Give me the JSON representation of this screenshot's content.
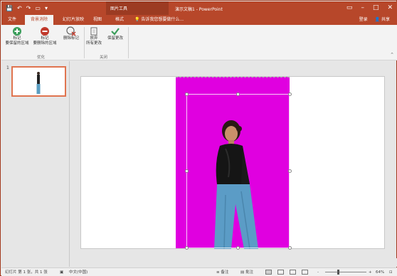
{
  "window": {
    "title": "演示文稿1 - PowerPoint",
    "context_tab_header": "图片工具"
  },
  "quick_access": {
    "save_icon": "save-icon",
    "undo_icon": "undo-icon",
    "redo_icon": "redo-icon",
    "customize_icon": "customize-icon"
  },
  "tabs": [
    {
      "label": "文件"
    },
    {
      "label": "背景消除"
    },
    {
      "label": "幻灯片放映"
    },
    {
      "label": "视图"
    },
    {
      "label": "格式"
    }
  ],
  "tell_me": "告诉我您想要做什么...",
  "account": {
    "sign_in": "登录",
    "share": "共享"
  },
  "ribbon": {
    "buttons": {
      "mark_keep": "标记\n要保留的区域",
      "mark_remove": "标记\n要删除的区域",
      "delete_mark": "删除标记",
      "discard": "放弃\n所有更改",
      "keep_changes": "保留更改"
    },
    "groups": {
      "optimize": "优化",
      "close": "关闭"
    }
  },
  "slides_pane": {
    "slide_number": "1"
  },
  "status": {
    "slide_info": "幻灯片 第 1 张，共 1 张",
    "language": "中文(中国)",
    "notes": "备注",
    "comments": "批注",
    "zoom_minus": "-",
    "zoom_plus": "+",
    "zoom": "64%"
  },
  "colors": {
    "accent": "#b7472a",
    "background_removal": "#e000e0",
    "keep_icon": "#3a9d5a",
    "remove_icon": "#c0392b"
  },
  "zoom_level_fraction": 0.64
}
